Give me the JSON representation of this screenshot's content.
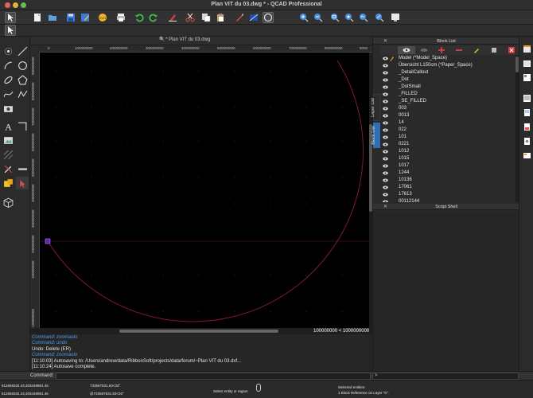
{
  "window": {
    "title": "Plan VIT du 03.dwg * - QCAD Professional"
  },
  "document": {
    "tab_label": "* Plan VIT du 03.dwg"
  },
  "toolbar": {
    "icons": [
      "pointer-icon",
      "new-file-icon",
      "open-file-icon",
      "save-icon",
      "save-as-icon",
      "svg-export-icon",
      "print-icon",
      "undo-icon",
      "redo-icon",
      "paint-icon",
      "brush-icon",
      "cut-icon",
      "copy-icon",
      "paste-icon",
      "pen-icon",
      "rect-fill-icon",
      "reset-icon",
      "zoom-in-icon",
      "zoom-out-icon",
      "zoom-window-icon",
      "zoom-auto-icon",
      "zoom-prev-icon",
      "zoom-selection-icon",
      "pan-icon"
    ]
  },
  "rulers": {
    "horizontal": [
      "0",
      "100000000",
      "200000000",
      "300000000",
      "400000000",
      "500000000",
      "600000000",
      "700000000",
      "800000000",
      "9000"
    ],
    "vertical": [
      "900000000",
      "800000000",
      "700000000",
      "600000000",
      "500000000",
      "400000000",
      "300000000",
      "200000000",
      "100000000",
      "0",
      "-100000000"
    ]
  },
  "canvas": {
    "scale_label": "100000000 < 1000000000"
  },
  "console": {
    "lines": [
      {
        "text": "Command: zoomauto",
        "style": "blue"
      },
      {
        "text": "Command: undo",
        "style": "blue"
      },
      {
        "text": "Undo: Delete (ER)",
        "style": "white"
      },
      {
        "text": "Command: zoomauto",
        "style": "blue"
      },
      {
        "text": "[11:10:03] Autosaving to: /Users/andrew/data/RibbonSoft/projects/data/forum/~Plan VIT du 03.dxf...",
        "style": "white"
      },
      {
        "text": "[11:10:24] Autosave complete.",
        "style": "white"
      }
    ]
  },
  "command_line": {
    "label": "Command:",
    "right_prompt": ">"
  },
  "status": {
    "abs_coord_1": "612658334.43,403448991.46",
    "abs_coord_2": "612658334.43,403448991.46",
    "rel_coord_1": "733567531.63<33°",
    "rel_coord_2": "@733567531.63<33°",
    "hint": "Select entity or region",
    "selection_line1": "Selected entities:",
    "selection_line2": "1 Block Reference on Layer \"0\"."
  },
  "block_list": {
    "title": "Block List",
    "items": [
      "Model (*Model_Space)",
      "Übersicht L150cm (*Paper_Space)",
      "_DetailCallout",
      "_Dot",
      "_DotSmall",
      "_FILLED",
      "_SE_FILLED",
      "003",
      "0013",
      "14",
      "022",
      "101",
      "0221",
      "1012",
      "1015",
      "1017",
      "1244",
      "10136",
      "17061",
      "17613",
      "00112144"
    ]
  },
  "side_tabs": {
    "layer_list": "Layer List",
    "block_list": "Block List"
  },
  "script_shell": {
    "title": "Script Shell"
  },
  "colors": {
    "arc": "#8a1f2a",
    "accent": "#2d6fb2",
    "canvas_bg": "#000000"
  }
}
